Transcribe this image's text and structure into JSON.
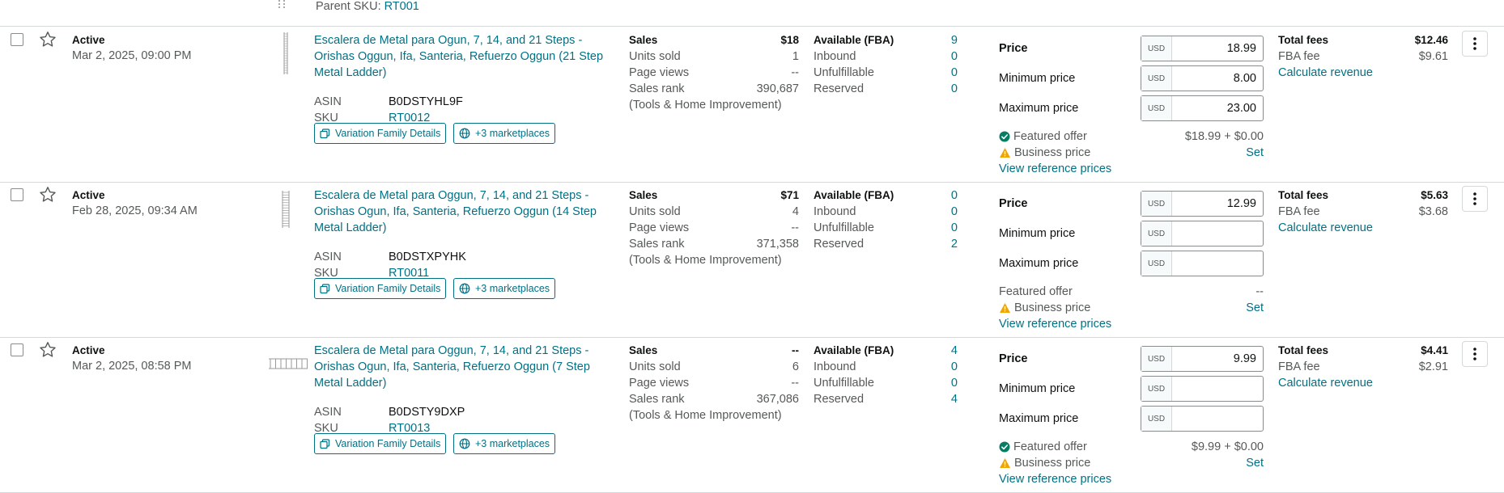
{
  "top": {
    "parent_sku_label": "Parent SKU:",
    "parent_sku_value": "RT001"
  },
  "listings": [
    {
      "status": "Active",
      "date": "Mar 2, 2025, 09:00 PM",
      "title": "Escalera de Metal para Ogun, 7, 14, and 21 Steps - Orishas Oggun, Ifa, Santeria, Refuerzo Oggun (21 Step Metal Ladder)",
      "asin_label": "ASIN",
      "asin": "B0DSTYHL9F",
      "sku_label": "SKU",
      "sku": "RT0012",
      "variation_btn": "Variation Family Details",
      "marketplaces_btn": "+3 marketplaces",
      "sales_label": "Sales",
      "sales": "$18",
      "units_label": "Units sold",
      "units": "1",
      "views_label": "Page views",
      "views": "--",
      "rank_label": "Sales rank",
      "rank": "390,687",
      "category": "(Tools & Home Improvement)",
      "available_label": "Available (FBA)",
      "available": "9",
      "inbound_label": "Inbound",
      "inbound": "0",
      "unfulfillable_label": "Unfulfillable",
      "unfulfillable": "0",
      "reserved_label": "Reserved",
      "reserved": "0",
      "price_label": "Price",
      "currency": "USD",
      "price": "18.99",
      "min_label": "Minimum price",
      "min_price": "8.00",
      "max_label": "Maximum price",
      "max_price": "23.00",
      "featured_label": "Featured offer",
      "featured_value": "$18.99 + $0.00",
      "featured_status": "check",
      "business_label": "Business price",
      "business_value": "Set",
      "ref_link": "View reference prices",
      "fees_label": "Total fees",
      "fees": "$12.46",
      "fba_label": "FBA fee",
      "fba": "$9.61",
      "calc_link": "Calculate revenue"
    },
    {
      "status": "Active",
      "date": "Feb 28, 2025, 09:34 AM",
      "title": "Escalera de Metal para Oggun, 7, 14, and 21 Steps - Orishas Ogun, Ifa, Santeria, Refuerzo Oggun (14 Step Metal Ladder)",
      "asin_label": "ASIN",
      "asin": "B0DSTXPYHK",
      "sku_label": "SKU",
      "sku": "RT0011",
      "variation_btn": "Variation Family Details",
      "marketplaces_btn": "+3 marketplaces",
      "sales_label": "Sales",
      "sales": "$71",
      "units_label": "Units sold",
      "units": "4",
      "views_label": "Page views",
      "views": "--",
      "rank_label": "Sales rank",
      "rank": "371,358",
      "category": "(Tools & Home Improvement)",
      "available_label": "Available (FBA)",
      "available": "0",
      "inbound_label": "Inbound",
      "inbound": "0",
      "unfulfillable_label": "Unfulfillable",
      "unfulfillable": "0",
      "reserved_label": "Reserved",
      "reserved": "2",
      "price_label": "Price",
      "currency": "USD",
      "price": "12.99",
      "min_label": "Minimum price",
      "min_price": "",
      "max_label": "Maximum price",
      "max_price": "",
      "featured_label": "Featured offer",
      "featured_value": "--",
      "featured_status": "none",
      "business_label": "Business price",
      "business_value": "Set",
      "ref_link": "View reference prices",
      "fees_label": "Total fees",
      "fees": "$5.63",
      "fba_label": "FBA fee",
      "fba": "$3.68",
      "calc_link": "Calculate revenue"
    },
    {
      "status": "Active",
      "date": "Mar 2, 2025, 08:58 PM",
      "title": "Escalera de Metal para Oggun, 7, 14, and 21 Steps - Orishas Ogun, Ifa, Santeria, Refuerzo Oggun (7 Step Metal Ladder)",
      "asin_label": "ASIN",
      "asin": "B0DSTY9DXP",
      "sku_label": "SKU",
      "sku": "RT0013",
      "variation_btn": "Variation Family Details",
      "marketplaces_btn": "+3 marketplaces",
      "sales_label": "Sales",
      "sales": "--",
      "units_label": "Units sold",
      "units": "6",
      "views_label": "Page views",
      "views": "--",
      "rank_label": "Sales rank",
      "rank": "367,086",
      "category": "(Tools & Home Improvement)",
      "available_label": "Available (FBA)",
      "available": "4",
      "inbound_label": "Inbound",
      "inbound": "0",
      "unfulfillable_label": "Unfulfillable",
      "unfulfillable": "0",
      "reserved_label": "Reserved",
      "reserved": "4",
      "price_label": "Price",
      "currency": "USD",
      "price": "9.99",
      "min_label": "Minimum price",
      "min_price": "",
      "max_label": "Maximum price",
      "max_price": "",
      "featured_label": "Featured offer",
      "featured_value": "$9.99 + $0.00",
      "featured_status": "check",
      "business_label": "Business price",
      "business_value": "Set",
      "ref_link": "View reference prices",
      "fees_label": "Total fees",
      "fees": "$4.41",
      "fba_label": "FBA fee",
      "fba": "$2.91",
      "calc_link": "Calculate revenue"
    }
  ],
  "colors": {
    "link": "#007185",
    "check": "#067d62",
    "warning": "#f0a500",
    "border": "#d5d9d9"
  },
  "icons": {
    "favorite": "star-outline-icon",
    "variation": "copy-icon",
    "marketplaces": "globe-icon",
    "featured": "check-circle-icon",
    "business": "warning-triangle-icon",
    "more": "vertical-ellipsis-icon"
  }
}
